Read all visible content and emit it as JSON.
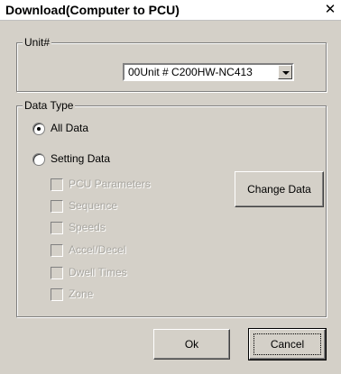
{
  "window": {
    "title": "Download(Computer to PCU)"
  },
  "unit_group": {
    "label": "Unit#",
    "selected": "00Unit # C200HW-NC413"
  },
  "data_type_group": {
    "label": "Data Type",
    "options": [
      "All Data",
      "Setting Data"
    ],
    "selected_option": "All Data",
    "checkboxes": [
      "PCU Parameters",
      "Sequence",
      "Speeds",
      "Accel/Decel",
      "Dwell Times",
      "Zone"
    ],
    "checkboxes_disabled": true,
    "change_data_label": "Change Data"
  },
  "buttons": {
    "ok": "Ok",
    "cancel": "Cancel"
  },
  "colors": {
    "face": "#d4d0c8",
    "disabled_text": "#a8a6a0"
  }
}
